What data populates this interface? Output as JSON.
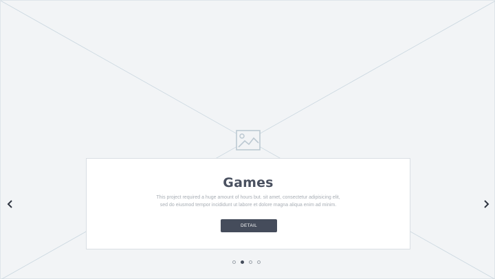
{
  "slide": {
    "title": "Games",
    "description_line1": "This project required a huge amount of hours but. sit amet, consectetur adipisicing elit,",
    "description_line2": "sed do eiusmod tempor incididunt ut labore et dolore magna aliqua enim ad minim.",
    "button_label": "DETAIL"
  },
  "navigation": {
    "prev_icon": "chevron-left-icon",
    "next_icon": "chevron-right-icon"
  },
  "pagination": {
    "count": 4,
    "active_index": 1
  },
  "colors": {
    "background": "#f2f4f6",
    "card": "#ffffff",
    "title": "#4a5160",
    "button": "#454c5b",
    "placeholder_lines": "#c9d6df"
  }
}
